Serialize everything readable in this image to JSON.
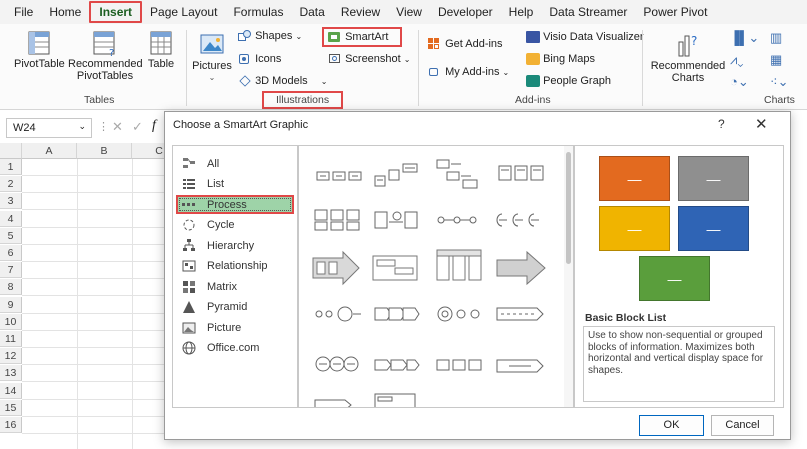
{
  "menu": [
    "File",
    "Home",
    "Insert",
    "Page Layout",
    "Formulas",
    "Data",
    "Review",
    "View",
    "Developer",
    "Help",
    "Data Streamer",
    "Power Pivot"
  ],
  "ribbon": {
    "pivottable": "PivotTable",
    "recommended_pivottables_1": "Recommended",
    "recommended_pivottables_2": "PivotTables",
    "table": "Table",
    "tables_group": "Tables",
    "pictures": "Pictures",
    "shapes": "Shapes",
    "icons": "Icons",
    "models3d": "3D Models",
    "smartart": "SmartArt",
    "screenshot": "Screenshot",
    "illustrations_group": "Illustrations",
    "get_addins": "Get Add-ins",
    "my_addins": "My Add-ins",
    "visio": "Visio Data Visualizer",
    "bing_maps": "Bing Maps",
    "people_graph": "People Graph",
    "addins_group": "Add-ins",
    "recommended_charts_1": "Recommended",
    "recommended_charts_2": "Charts",
    "charts_group": "Charts"
  },
  "formula_bar": {
    "namebox": "W24",
    "fx": "f"
  },
  "columns": [
    "A",
    "B",
    "C"
  ],
  "rows": [
    "1",
    "2",
    "3",
    "4",
    "5",
    "6",
    "7",
    "8",
    "9",
    "10",
    "11",
    "12",
    "13",
    "14",
    "15",
    "16"
  ],
  "dialog": {
    "title": "Choose a SmartArt Graphic",
    "help": "?",
    "close": "✕",
    "categories": [
      {
        "label": "All",
        "icon": "all-icon"
      },
      {
        "label": "List",
        "icon": "list-icon"
      },
      {
        "label": "Process",
        "icon": "process-icon"
      },
      {
        "label": "Cycle",
        "icon": "cycle-icon"
      },
      {
        "label": "Hierarchy",
        "icon": "hierarchy-icon"
      },
      {
        "label": "Relationship",
        "icon": "relationship-icon"
      },
      {
        "label": "Matrix",
        "icon": "matrix-icon"
      },
      {
        "label": "Pyramid",
        "icon": "pyramid-icon"
      },
      {
        "label": "Picture",
        "icon": "picture-icon"
      },
      {
        "label": "Office.com",
        "icon": "office-com-icon"
      }
    ],
    "selected_category": "Process",
    "preview": {
      "title": "Basic Block List",
      "description": "Use to show non-sequential or grouped blocks of information. Maximizes both horizontal and vertical display space for shapes.",
      "block_colors": [
        "#e36a1f",
        "#8f8f8f",
        "#f0b400",
        "#2f64b5",
        "#5a9e3c"
      ],
      "block_glyph": "—"
    },
    "ok": "OK",
    "cancel": "Cancel"
  }
}
